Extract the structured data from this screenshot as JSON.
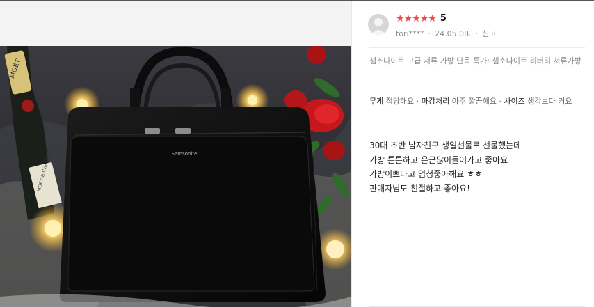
{
  "review": {
    "stars": [
      "★",
      "★",
      "★",
      "★",
      "★"
    ],
    "score": "5",
    "user": "tori****",
    "date": "24.05.08.",
    "report": "신고",
    "product_title": "샘소나이트 고급 서류 가방 단독 특가: 샘소나이트 리버티 서류가방",
    "attributes": [
      {
        "name": "무게",
        "value": "적당해요"
      },
      {
        "name": "마감처리",
        "value": "아주 깔끔해요"
      },
      {
        "name": "사이즈",
        "value": "생각보다 커요"
      }
    ],
    "attr_separator": " · ",
    "body": [
      "30대 초반 남자친구 생일선물로 선물했는데",
      "가방 튼튼하고 은근많이들어가고 좋아요",
      "가방이쁘다고 엄청좋아해요 ㅎㅎ",
      "판매자님도 친절하고 좋아요!"
    ]
  },
  "photo": {
    "brand_text": "Samsonite",
    "bottle_label": "MOËT",
    "bottle_label2": "MOET & CHANDON",
    "colors": {
      "bag": "#121212",
      "background": "#2a2a2e",
      "rose": "#c4181c",
      "light": "#ffd66b"
    }
  },
  "colors": {
    "star": "#f0493e",
    "meta": "#8a8a8a",
    "text": "#222222"
  }
}
